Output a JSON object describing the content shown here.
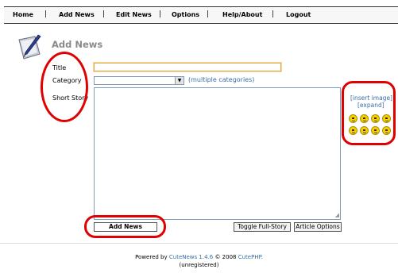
{
  "nav": {
    "items": [
      "Home",
      "Add News",
      "Edit News",
      "Options",
      "Help/About",
      "Logout"
    ],
    "separator": "|"
  },
  "page": {
    "title": "Add News",
    "icon": "quill-pen-icon"
  },
  "form": {
    "title_label": "Title",
    "title_value": "",
    "category_label": "Category",
    "category_selected": "",
    "multiple_categories_link": "(multiple categories)",
    "short_story_label": "Short Story",
    "short_story_value": ""
  },
  "side_panel": {
    "insert_image": "[insert image]",
    "expand": "[expand]",
    "smileys": [
      "smile",
      "wink",
      "tongue",
      "cool",
      "grin",
      "sad",
      "angry",
      "crying"
    ]
  },
  "buttons": {
    "add_news": "Add News",
    "toggle_full_story": "Toggle Full-Story",
    "article_options": "Article Options"
  },
  "footer": {
    "powered_by": "Powered by",
    "product": "CuteNews 1.4.6",
    "copyright": "© 2008",
    "company": "CutePHP.",
    "registration": "(unregistered)"
  },
  "annotation_color": "#e00000"
}
